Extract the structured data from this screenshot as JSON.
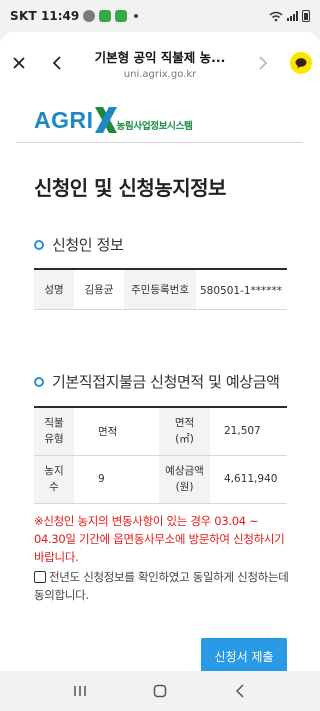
{
  "status_bar": {
    "carrier": "SKT",
    "time": "11:49",
    "icons": [
      "talk-icon",
      "g-app-icon",
      "g-app-icon",
      "notification-dot",
      "wifi-icon",
      "signal-icon",
      "battery-icon"
    ]
  },
  "browser": {
    "title": "기본형 공익 직불제 농...",
    "url": "uni.agrix.go.kr",
    "icons": [
      "close-icon",
      "back-icon",
      "forward-icon",
      "kakao-chat-icon"
    ]
  },
  "logo": {
    "brand": "AGRI",
    "subtitle": "농림사업정보시스템",
    "colors": {
      "blue": "#1f87c3",
      "green": "#1a8a3e"
    }
  },
  "page_title": "신청인 및 신청농지정보",
  "applicant": {
    "section_title": "신청인 정보",
    "name_label": "성명",
    "name_value": "김용균",
    "rrn_label": "주민등록번호",
    "rrn_value": "580501-1******"
  },
  "subsidy": {
    "section_title": "기본직접지불금 신청면적 및 예상금액",
    "rows": [
      {
        "label1": "직불\n유형",
        "value1": "면적",
        "label2": "면적\n(㎡)",
        "value2": "21,507"
      },
      {
        "label1": "농지\n수",
        "value1": "9",
        "label2": "예상금액\n(원)",
        "value2": "4,611,940"
      }
    ]
  },
  "notice": "※신청인 농지의 변동사항이 있는 경우 03.04 ~ 04.30일 기간에 읍면동사무소에 방문하여 신청하시기 바랍니다.",
  "agreement": "전년도 신청정보를 확인하였고 동일하게 신청하는데 동의합니다.",
  "submit_label": "신청서 제출",
  "colors": {
    "accent": "#2b9ae6",
    "notice": "#e01b1b"
  },
  "nav": {
    "icons": [
      "recents-icon",
      "home-icon",
      "back-nav-icon"
    ]
  }
}
